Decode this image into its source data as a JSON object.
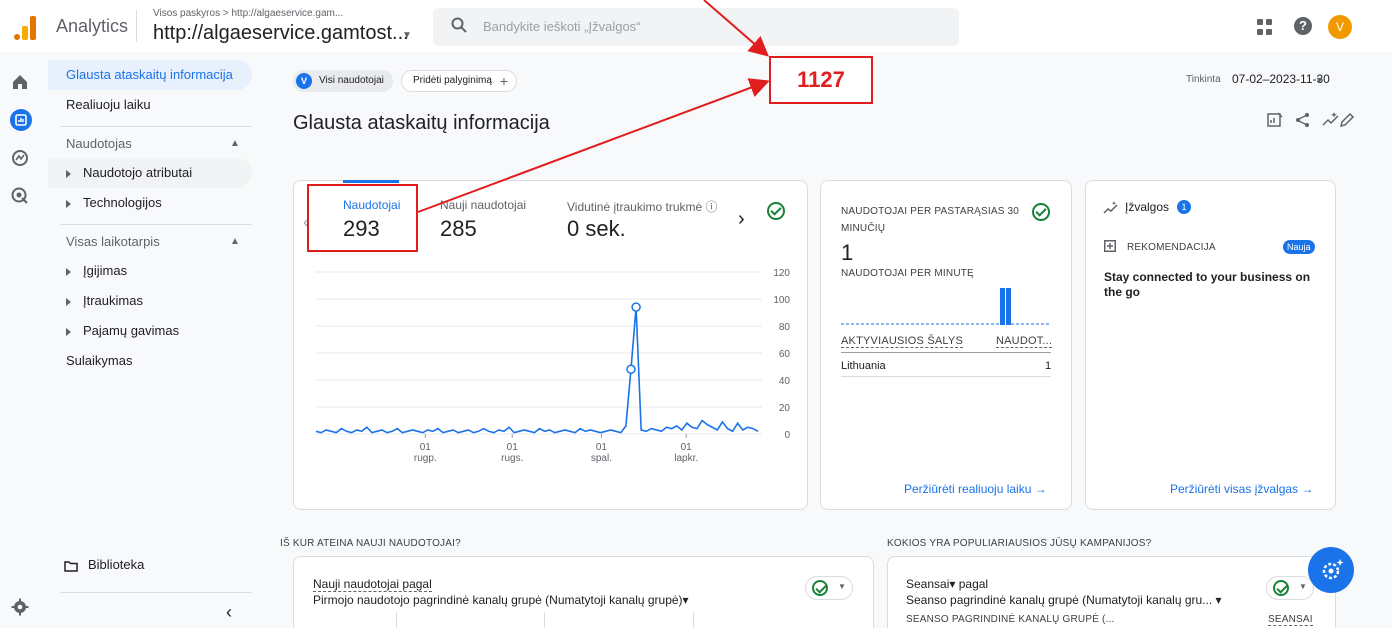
{
  "topbar": {
    "app_name": "Analytics",
    "breadcrumb": "Visos paskyros > http://algaeservice.gam...",
    "property_name": "http://algaeservice.gamtost...",
    "search_placeholder": "Bandykite ieškoti „Įžvalgos“",
    "avatar_letter": "V"
  },
  "nav": {
    "items_top": [
      "Glausta ataskaitų informacija",
      "Realiuoju laiku"
    ],
    "section_user": "Naudotojas",
    "user_items": [
      "Naudotojo atributai",
      "Technologijos"
    ],
    "section_lifetime": "Visas laikotarpis",
    "lifetime_items": [
      "Įgijimas",
      "Įtraukimas",
      "Pajamų gavimas"
    ],
    "retention": "Sulaikymas",
    "library": "Biblioteka"
  },
  "filters": {
    "segment_letter": "V",
    "segment": "Visi naudotojai",
    "add_comparison": "Pridėti palyginimą",
    "date_label": "Tinkinta",
    "date_range": "07-02–2023-11-30"
  },
  "page_title": "Glausta ataskaitų informacija",
  "metrics": [
    {
      "label": "Naudotojai",
      "value": "293"
    },
    {
      "label": "Nauji naudotojai",
      "value": "285"
    },
    {
      "label": "Vidutinė įtraukimo trukmė ⓘ",
      "value": "0 sek."
    }
  ],
  "chart_data": {
    "type": "line",
    "y_ticks": [
      0,
      20,
      40,
      60,
      80,
      100,
      120
    ],
    "ylim": [
      0,
      120
    ],
    "x_tick_labels": [
      {
        "day": "01",
        "month": "rugp."
      },
      {
        "day": "01",
        "month": "rugs."
      },
      {
        "day": "01",
        "month": "spal."
      },
      {
        "day": "01",
        "month": "lapkr."
      }
    ],
    "series": [
      {
        "values": [
          2,
          1,
          3,
          2,
          1,
          4,
          2,
          1,
          3,
          2,
          5,
          1,
          2,
          3,
          1,
          2,
          4,
          1,
          2,
          3,
          2,
          1,
          3,
          2,
          4,
          1,
          2,
          3,
          1,
          2,
          3,
          1,
          2,
          4,
          2,
          1,
          3,
          2,
          5,
          1,
          2,
          3,
          2,
          1,
          4,
          2,
          3,
          1,
          2,
          3,
          2,
          1,
          4,
          2,
          3,
          2,
          1,
          2,
          3,
          2,
          1,
          6,
          48,
          94,
          3,
          2,
          4,
          3,
          2,
          5,
          4,
          6,
          3,
          8,
          5,
          4,
          10,
          7,
          5,
          3,
          9,
          4,
          2,
          8,
          3,
          5,
          4,
          2
        ]
      }
    ]
  },
  "realtime": {
    "title": "NAUDOTOJAI PER PASTARĄSIAS 30 MINUČIŲ",
    "value": "1",
    "per_minute": "NAUDOTOJAI PER MINUTĘ",
    "col_country": "AKTYVIAUSIOS ŠALYS",
    "col_users": "NAUDOT...",
    "rows": [
      {
        "country": "Lithuania",
        "users": "1"
      }
    ],
    "link": "Peržiūrėti realiuoju laiku →"
  },
  "insights": {
    "title": "Įžvalgos",
    "badge": "1",
    "rec_label": "REKOMENDACIJA",
    "new_badge": "Nauja",
    "text": "Stay connected to your business on the go",
    "link": "Peržiūrėti visas įžvalgas →"
  },
  "section_new_users": {
    "heading": "IŠ KUR ATEINA NAUJI NAUDOTOJAI?",
    "card_line1": "Nauji naudotojai pagal",
    "card_line2": "Pirmojo naudotojo pagrindinė kanalų grupė (Numatytoji kanalų grupė)▾"
  },
  "section_campaigns": {
    "heading": "KOKIOS YRA POPULIARIAUSIOS JŪSŲ KAMPANIJOS?",
    "card_line1": "Seansai▾ pagal",
    "card_line2": "Seanso pagrindinė kanalų grupė (Numatytoji kanalų gru... ▾",
    "col1": "SEANSO PAGRINDINĖ KANALŲ GRUPĖ (...",
    "col2": "SEANSAI"
  },
  "annotation": {
    "label": "1127",
    "color": "#e01e1e"
  }
}
